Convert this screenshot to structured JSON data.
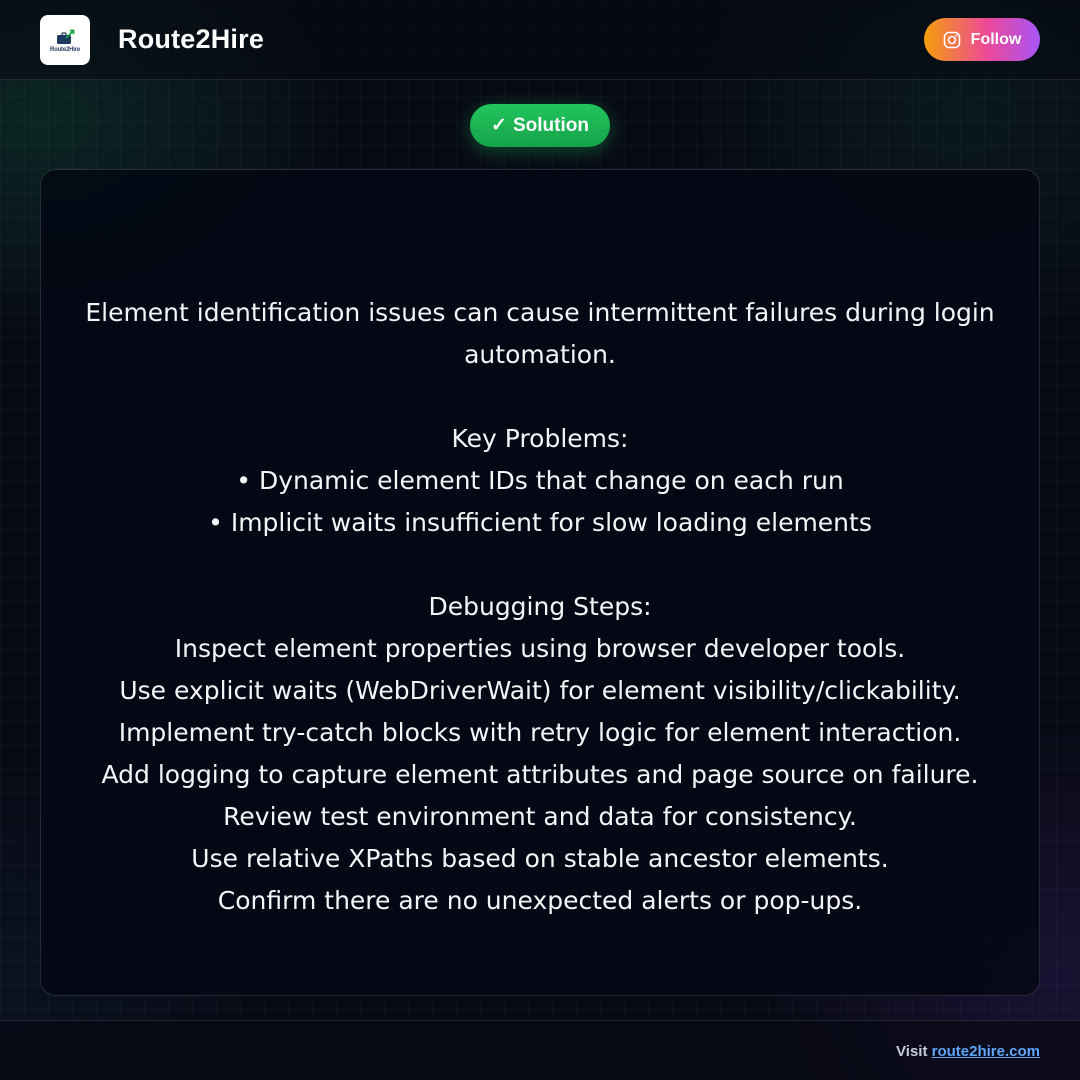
{
  "header": {
    "logo_text": "Route2Hire",
    "brand": "Route2Hire",
    "follow_label": "Follow"
  },
  "badge": {
    "check": "✓",
    "label": "Solution"
  },
  "content": {
    "intro": "Element identification issues can cause intermittent failures during login automation.",
    "problems_heading": "Key Problems:",
    "problems": [
      "• Dynamic element IDs that change on each run",
      "• Implicit waits insufficient for slow loading elements"
    ],
    "steps_heading": "Debugging Steps:",
    "steps": [
      "Inspect element properties using browser developer tools.",
      "Use explicit waits (WebDriverWait) for element visibility/clickability.",
      "Implement try-catch blocks with retry logic for element interaction.",
      "Add logging to capture element attributes and page source on failure.",
      "Review test environment and data for consistency.",
      "Use relative XPaths based on stable ancestor elements.",
      "Confirm there are no unexpected alerts or pop-ups."
    ]
  },
  "footer": {
    "visit_prefix": "Visit",
    "link": "route2hire.com"
  },
  "colors": {
    "accent_green": "#22c55e",
    "link_blue": "#60a5fa",
    "instagram_gradient_start": "#f59e0b",
    "instagram_gradient_end": "#a855f7"
  },
  "icons": {
    "logo": "route2hire-logo",
    "follow": "instagram-icon",
    "badge": "checkmark"
  }
}
